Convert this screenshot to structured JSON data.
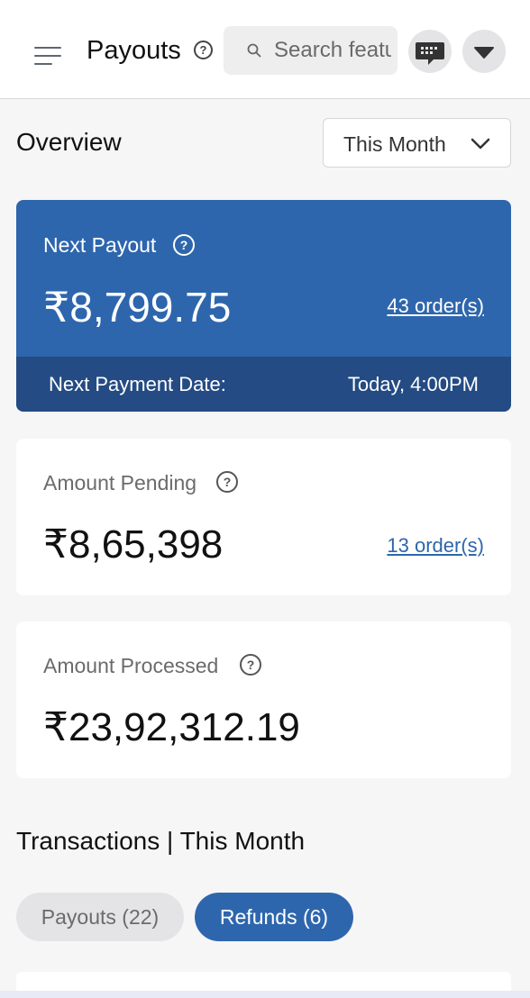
{
  "header": {
    "title": "Payouts",
    "help_symbol": "?",
    "search_placeholder": "Search features",
    "chat_icon": "chat-bubble-icon",
    "account_icon": "caret-down-icon"
  },
  "overview": {
    "title": "Overview",
    "period_selected": "This Month"
  },
  "next_payout": {
    "label": "Next Payout",
    "amount": "₹8,799.75",
    "orders_link": "43 order(s)",
    "date_label": "Next Payment Date:",
    "date_value": "Today, 4:00PM"
  },
  "amount_pending": {
    "label": "Amount Pending",
    "amount": "₹8,65,398",
    "orders_link": "13 order(s)"
  },
  "amount_processed": {
    "label": "Amount Processed",
    "amount": "₹23,92,312.19"
  },
  "transactions": {
    "title": "Transactions | This Month",
    "tabs": [
      {
        "label": "Payouts (22)",
        "active": false
      },
      {
        "label": "Refunds (6)",
        "active": true
      }
    ]
  },
  "colors": {
    "primary": "#2e66ad",
    "primary_dark": "#244b83",
    "background": "#f6f6f7"
  }
}
